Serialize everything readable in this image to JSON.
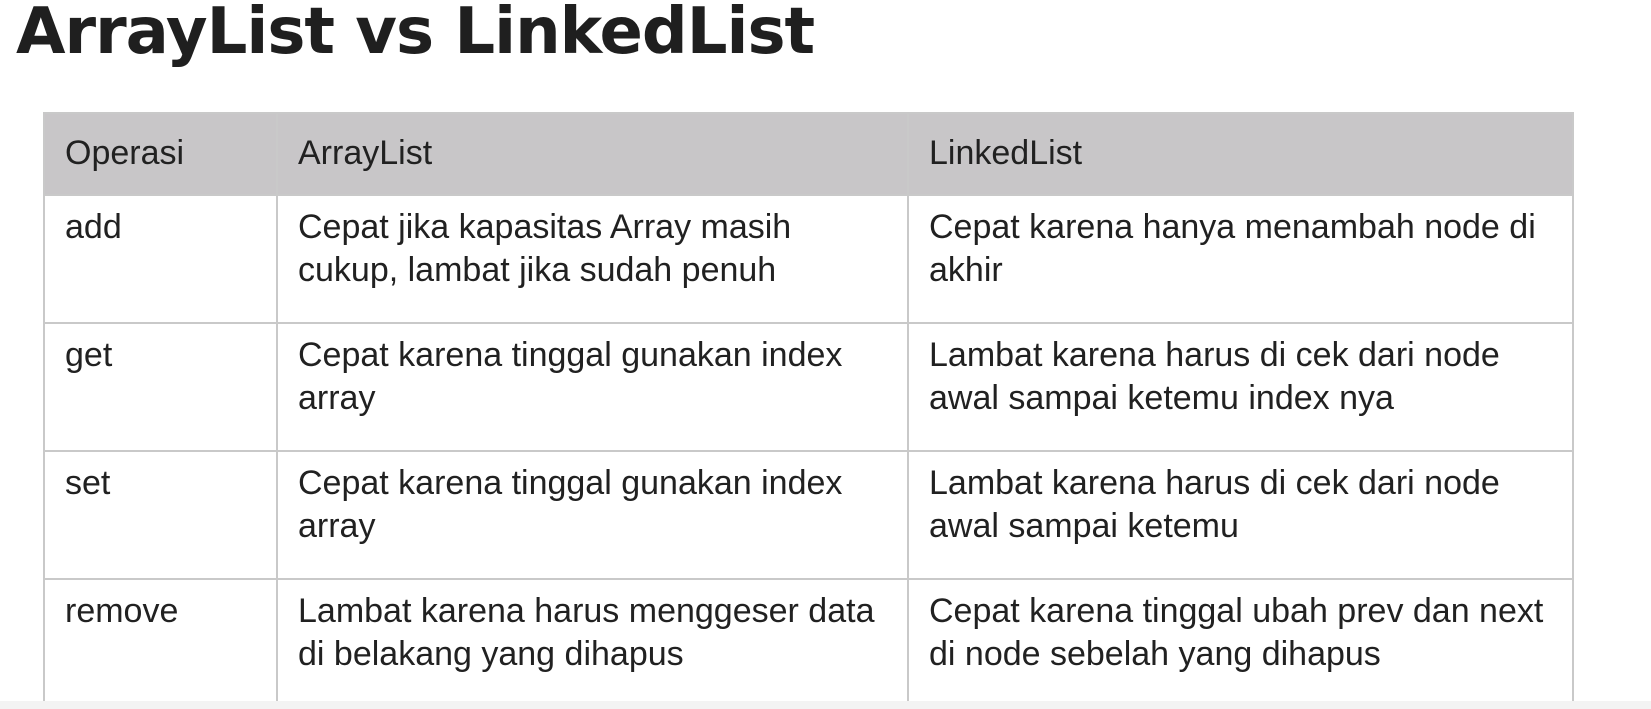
{
  "title": "ArrayList vs LinkedList",
  "table": {
    "headers": [
      "Operasi",
      "ArrayList",
      "LinkedList"
    ],
    "rows": [
      {
        "operation": "add",
        "arraylist": "Cepat jika kapasitas Array masih cukup, lambat jika sudah penuh",
        "linkedlist": "Cepat karena hanya menambah node di akhir"
      },
      {
        "operation": "get",
        "arraylist": "Cepat karena tinggal gunakan index array",
        "linkedlist": "Lambat karena harus di cek dari node awal sampai ketemu index nya"
      },
      {
        "operation": "set",
        "arraylist": "Cepat karena tinggal gunakan index array",
        "linkedlist": "Lambat karena harus di cek dari node awal sampai ketemu"
      },
      {
        "operation": "remove",
        "arraylist": "Lambat karena harus menggeser data di belakang yang dihapus",
        "linkedlist": "Cepat karena tinggal ubah prev dan next di node sebelah yang dihapus"
      }
    ]
  },
  "colors": {
    "header_bg": "#c8c6c8",
    "border": "#c9c9c9",
    "text": "#212121"
  }
}
